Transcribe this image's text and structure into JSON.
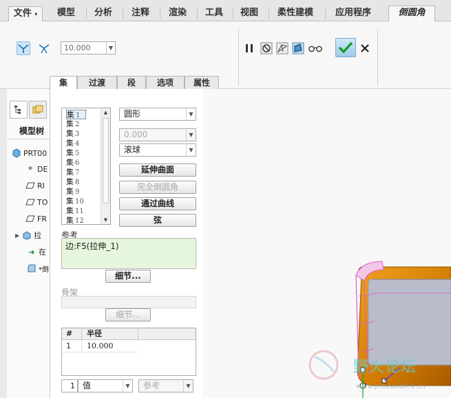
{
  "menu": {
    "file": "文件",
    "tabs": [
      "模型",
      "分析",
      "注释",
      "渲染",
      "工具",
      "视图",
      "柔性建模",
      "应用程序"
    ],
    "active_tab": "倒圆角"
  },
  "ribbon": {
    "radius_value": "10.000"
  },
  "panel_tabs": [
    "集",
    "过渡",
    "段",
    "选项",
    "属性"
  ],
  "model_tree": {
    "title": "模型树",
    "items": [
      "PRT00",
      "DE",
      "RI",
      "TO",
      "FR",
      "拉",
      "在",
      "*倒"
    ]
  },
  "sets": {
    "items": [
      {
        "label": "集",
        "num": "1"
      },
      {
        "label": "集",
        "num": "2"
      },
      {
        "label": "集",
        "num": "3"
      },
      {
        "label": "集",
        "num": "4"
      },
      {
        "label": "集",
        "num": "5"
      },
      {
        "label": "集",
        "num": "6"
      },
      {
        "label": "集",
        "num": "7"
      },
      {
        "label": "集",
        "num": "8"
      },
      {
        "label": "集",
        "num": "9"
      },
      {
        "label": "集",
        "num": "10"
      },
      {
        "label": "集",
        "num": "11"
      },
      {
        "label": "集",
        "num": "12"
      }
    ],
    "shape": "圆形",
    "value": "0.000",
    "method": "滚球",
    "btn_extend": "延伸曲面",
    "btn_full": "完全倒圆角",
    "btn_through": "通过曲线",
    "btn_chord": "弦"
  },
  "references": {
    "label": "参考",
    "value": "边:F5(拉伸_1)",
    "details": "细节..."
  },
  "skeleton": {
    "label": "骨架",
    "details": "细节..."
  },
  "radius_table": {
    "col_num": "#",
    "col_radius": "半径",
    "rows": [
      {
        "num": "1",
        "radius": "10.000"
      }
    ]
  },
  "bottom": {
    "num": "1",
    "value_mode": "值",
    "reference": "参考"
  },
  "watermark": {
    "text": "野火论坛",
    "url": "www.proewildfire.cn"
  }
}
